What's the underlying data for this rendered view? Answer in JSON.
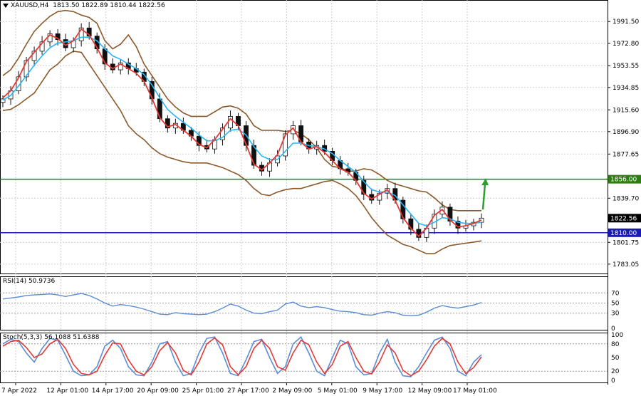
{
  "header": {
    "symbol": "XAUUSD,H4",
    "ohlc": "1813.50 1822.89 1810.44 1822.56",
    "menu_icon": "triangle-down-icon"
  },
  "rsi_header": "RSI(14) 50.9736",
  "stoch_header": "Stoch(5,3,3) 56.1088 51.6388",
  "colors": {
    "bullish_line": "#2e7d12",
    "bearish_line": "#1b1bb0",
    "price_tag_current": "#000000",
    "bollinger": "#8b5a2b",
    "ma_fast": "#e53935",
    "ma_slow": "#29b6f6",
    "rsi_line": "#5b8dd6",
    "stoch_main": "#5b8dd6",
    "stoch_signal": "#e53935",
    "arrow": "#2ca02c",
    "candle": "#111111"
  },
  "chart_data": [
    {
      "type": "line",
      "title": "XAUUSD,H4",
      "ylim": [
        1775.0,
        2010.0
      ],
      "y_ticks": [
        "1991.50",
        "1972.80",
        "1953.55",
        "1934.85",
        "1915.60",
        "1896.90",
        "1877.65",
        "1839.70",
        "1801.75",
        "1783.05"
      ],
      "x_ticks": [
        "7 Apr 2022",
        "12 Apr 01:00",
        "14 Apr 17:00",
        "20 Apr 09:00",
        "25 Apr 01:00",
        "27 Apr 17:00",
        "2 May 09:00",
        "5 May 01:00",
        "9 May 17:00",
        "12 May 09:00",
        "17 May 01:00"
      ],
      "horizontal_levels": [
        {
          "value": 1856.0,
          "label": "1856.00",
          "color": "#2e7d12"
        },
        {
          "value": 1810.0,
          "label": "1810.00",
          "color": "#1b1bb0"
        }
      ],
      "current_price": {
        "value": 1822.56,
        "label": "1822.56"
      },
      "series": [
        {
          "name": "close",
          "values": [
            1925,
            1932,
            1944,
            1958,
            1966,
            1974,
            1981,
            1976,
            1969,
            1975,
            1986,
            1979,
            1968,
            1955,
            1950,
            1956,
            1951,
            1948,
            1940,
            1925,
            1908,
            1900,
            1904,
            1898,
            1893,
            1885,
            1882,
            1890,
            1900,
            1910,
            1902,
            1885,
            1868,
            1863,
            1870,
            1876,
            1895,
            1902,
            1888,
            1882,
            1885,
            1880,
            1872,
            1865,
            1862,
            1855,
            1843,
            1838,
            1844,
            1848,
            1838,
            1822,
            1813,
            1806,
            1814,
            1826,
            1832,
            1820,
            1814,
            1816,
            1819,
            1822.56
          ]
        },
        {
          "name": "bb_upper",
          "values": [
            1945,
            1950,
            1960,
            1972,
            1983,
            1990,
            1996,
            2000,
            2001,
            2000,
            1997,
            1995,
            1990,
            1975,
            1968,
            1972,
            1980,
            1970,
            1955,
            1945,
            1935,
            1925,
            1918,
            1913,
            1910,
            1910,
            1910,
            1914,
            1918,
            1919,
            1917,
            1912,
            1902,
            1898,
            1898,
            1898,
            1897,
            1898,
            1895,
            1890,
            1883,
            1873,
            1867,
            1866,
            1863,
            1863,
            1865,
            1864,
            1860,
            1855,
            1852,
            1850,
            1848,
            1846,
            1845,
            1840,
            1834,
            1830,
            1829,
            1829,
            1829,
            1829
          ]
        },
        {
          "name": "bb_lower",
          "values": [
            1915,
            1916,
            1920,
            1925,
            1930,
            1940,
            1950,
            1955,
            1962,
            1966,
            1965,
            1955,
            1945,
            1935,
            1925,
            1915,
            1902,
            1895,
            1890,
            1883,
            1878,
            1875,
            1873,
            1871,
            1870,
            1870,
            1870,
            1868,
            1866,
            1863,
            1860,
            1855,
            1848,
            1843,
            1842,
            1845,
            1847,
            1848,
            1848,
            1850,
            1852,
            1854,
            1855,
            1852,
            1848,
            1842,
            1833,
            1823,
            1815,
            1808,
            1804,
            1800,
            1798,
            1795,
            1792,
            1792,
            1796,
            1799,
            1800,
            1801,
            1802,
            1803
          ]
        },
        {
          "name": "ma_fast",
          "values": [
            1926,
            1932,
            1943,
            1957,
            1965,
            1973,
            1980,
            1977,
            1971,
            1975,
            1985,
            1980,
            1969,
            1956,
            1951,
            1955,
            1951,
            1947,
            1940,
            1926,
            1909,
            1901,
            1903,
            1898,
            1893,
            1886,
            1883,
            1890,
            1899,
            1908,
            1902,
            1886,
            1869,
            1864,
            1870,
            1877,
            1894,
            1900,
            1888,
            1882,
            1884,
            1879,
            1872,
            1865,
            1862,
            1855,
            1844,
            1839,
            1843,
            1847,
            1838,
            1823,
            1814,
            1807,
            1814,
            1825,
            1830,
            1821,
            1815,
            1816,
            1818,
            1821
          ]
        },
        {
          "name": "ma_slow",
          "values": [
            1924,
            1928,
            1936,
            1945,
            1954,
            1962,
            1969,
            1973,
            1974,
            1975,
            1978,
            1978,
            1975,
            1968,
            1962,
            1959,
            1955,
            1951,
            1946,
            1937,
            1926,
            1916,
            1910,
            1905,
            1900,
            1894,
            1889,
            1889,
            1892,
            1898,
            1899,
            1894,
            1884,
            1876,
            1873,
            1873,
            1880,
            1887,
            1887,
            1885,
            1884,
            1882,
            1878,
            1872,
            1867,
            1862,
            1854,
            1847,
            1845,
            1845,
            1842,
            1834,
            1826,
            1818,
            1816,
            1819,
            1823,
            1822,
            1819,
            1818,
            1818,
            1819
          ]
        }
      ]
    },
    {
      "type": "line",
      "title": "RSI(14) 50.9736",
      "ylim": [
        0,
        100
      ],
      "y_ticks": [
        "70",
        "50",
        "30",
        "0"
      ],
      "levels": [
        70,
        50,
        30
      ],
      "series": [
        {
          "name": "RSI",
          "values": [
            58,
            60,
            62,
            65,
            66,
            67,
            68,
            66,
            63,
            66,
            69,
            65,
            58,
            50,
            44,
            47,
            45,
            42,
            38,
            33,
            28,
            27,
            31,
            29,
            28,
            27,
            28,
            33,
            40,
            48,
            44,
            36,
            30,
            29,
            33,
            36,
            48,
            52,
            44,
            41,
            43,
            41,
            37,
            34,
            33,
            31,
            27,
            26,
            30,
            33,
            31,
            26,
            25,
            26,
            32,
            40,
            45,
            42,
            40,
            43,
            46,
            50.97
          ]
        }
      ]
    },
    {
      "type": "line",
      "title": "Stoch(5,3,3) 56.1088 51.6388",
      "ylim": [
        0,
        100
      ],
      "y_ticks": [
        "100",
        "80",
        "50",
        "20",
        "0"
      ],
      "levels": [
        80,
        20
      ],
      "series": [
        {
          "name": "main",
          "values": [
            80,
            90,
            85,
            60,
            40,
            70,
            92,
            88,
            55,
            20,
            10,
            12,
            30,
            75,
            88,
            70,
            30,
            12,
            10,
            40,
            80,
            85,
            40,
            10,
            15,
            60,
            92,
            95,
            60,
            15,
            10,
            45,
            85,
            90,
            50,
            15,
            30,
            80,
            95,
            60,
            20,
            10,
            50,
            88,
            80,
            30,
            12,
            15,
            60,
            90,
            40,
            10,
            8,
            30,
            60,
            88,
            95,
            70,
            20,
            10,
            40,
            56.11
          ]
        },
        {
          "name": "signal",
          "values": [
            75,
            85,
            88,
            72,
            50,
            58,
            80,
            90,
            70,
            35,
            15,
            12,
            20,
            55,
            82,
            80,
            45,
            20,
            12,
            30,
            65,
            83,
            60,
            22,
            12,
            40,
            80,
            93,
            78,
            30,
            12,
            30,
            70,
            88,
            70,
            30,
            22,
            60,
            88,
            78,
            40,
            15,
            35,
            75,
            85,
            50,
            20,
            14,
            40,
            78,
            60,
            22,
            10,
            20,
            45,
            75,
            92,
            80,
            40,
            15,
            28,
            51.64
          ]
        }
      ]
    }
  ]
}
